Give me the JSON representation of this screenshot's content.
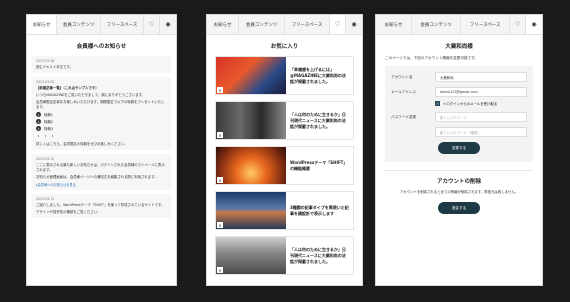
{
  "tabs": {
    "news": "お知らせ",
    "members": "会員コンテンツ",
    "free": "フリースペース",
    "heart_icon": "♡",
    "user_icon": "◉"
  },
  "panel1": {
    "title": "会員様へのお知らせ",
    "news": [
      {
        "date": "2023.03.28",
        "text": "読むテキスト本文です。"
      },
      {
        "date": "2023.03.25",
        "text": "【新着記事一覧】（これはサンプルです）",
        "text2": "いつもMAGAZINEをご覧いただきまして、誠にありがとうございます。",
        "text3": "会員様限定記事をお楽しみいただけます。期間限定で以下の特典をプレゼントいたします。",
        "items": [
          "特典1",
          "特典2",
          "特典3"
        ],
        "dots": "・・・",
        "text4": "詳しくはこちら、会員限定の特典をぜひお楽しみください。"
      },
      {
        "date": "2023.03.15",
        "text": "ここに表示される最も新しいお知らせは、ログインされた会員様のマイページに表示されます。",
        "text2": "お知らせ管理画面は、会員様ページへの通知文を編集される際に利用されます。",
        "link": "▸会員様へのお知らせを見る"
      },
      {
        "date": "2023.03.11",
        "text": "ご紹介しました、WordPressテーマ「SHIFT」を使って作成されているサイトです。",
        "text2": "デザインや操作性の確認をご覧ください。"
      }
    ]
  },
  "panel2": {
    "title": "お気に入り",
    "items": [
      {
        "text": "「幸福感を上げるには」@MAGAZINEに大業和尚の法話が掲載されました。"
      },
      {
        "text": "「人は何のために生きるか」日刊現代ニュースに大業和尚の法話が掲載されました。"
      },
      {
        "text": "WordPressテーマ「SHIFT」の機能概要"
      },
      {
        "text": "3種類の記事タイプを実現いた記事を顔設計で表示します"
      },
      {
        "text": "「人は何のために生きるか」日刊現代ニュースに大業和尚の法話が掲載されました。"
      }
    ],
    "badge": "✕"
  },
  "panel3": {
    "title": "大業和尚様",
    "lead": "このページでは、下記のアカウント情報を変更可能です。",
    "fields": {
      "account_label": "アカウント名",
      "account_value": "大業和尚",
      "email_label": "メールアドレス",
      "email_value": "daisui123@gmail.com",
      "checkbox_label": "＊ログインからのメールを受け取る",
      "checkbox_mark": "✓",
      "password_label": "パスワード変更",
      "password_placeholder": "新しいパスワード",
      "password_confirm_placeholder": "新しいパスワード（確認）"
    },
    "save_button": "変更する",
    "delete_title": "アカウントの削除",
    "delete_lead": "アカウントを削除されると全ての情報が削除されます。再復元は致しません。",
    "delete_button": "退会する"
  }
}
